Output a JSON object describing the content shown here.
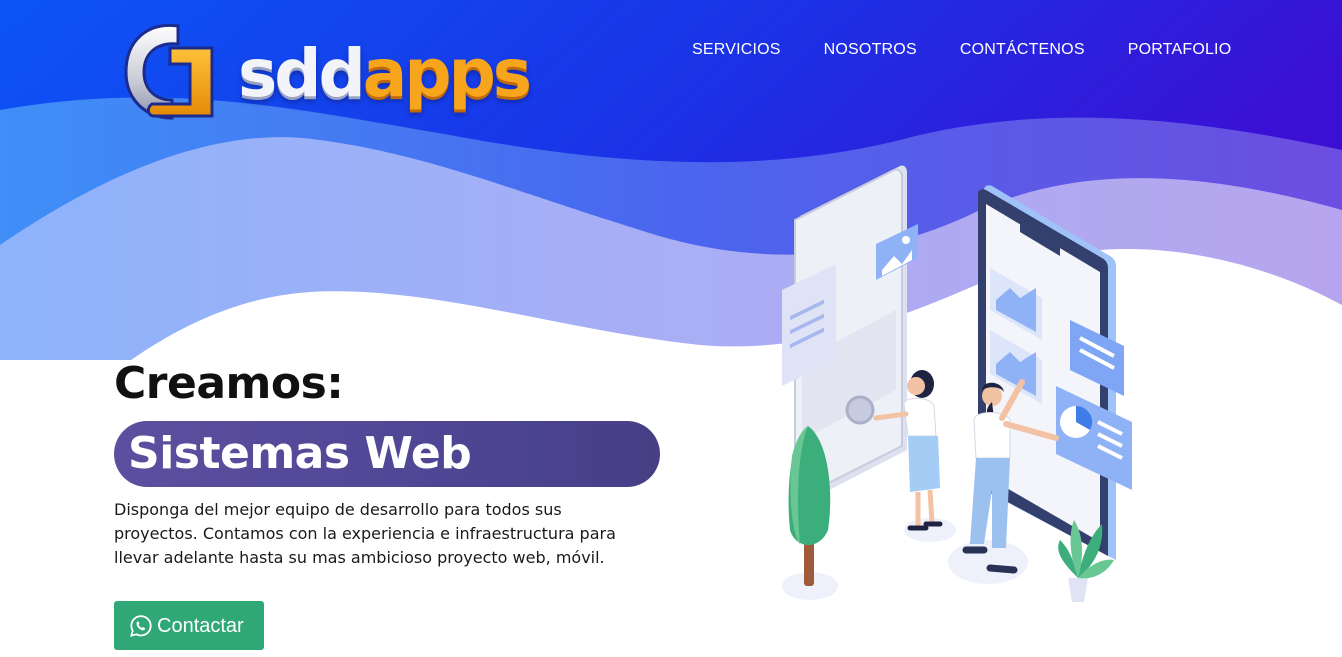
{
  "brand": {
    "logo_text_white": "sdd",
    "logo_text_orange": "apps",
    "logo_icon": "sddapps-logo-mark"
  },
  "nav": {
    "items": [
      {
        "label": "SERVICIOS"
      },
      {
        "label": "NOSOTROS"
      },
      {
        "label": "CONTÁCTENOS"
      },
      {
        "label": "PORTAFOLIO"
      }
    ]
  },
  "hero": {
    "title": "Creamos:",
    "highlight": "Sistemas Web",
    "description": "Disponga del mejor equipo de desarrollo para todos sus proyectos. Contamos con la experiencia e infraestructura para llevar adelante hasta su mas ambicioso proyecto web, móvil.",
    "cta_label": "Contactar",
    "cta_icon": "whatsapp-icon"
  },
  "colors": {
    "header_blue": "#1339ea",
    "header_violet": "#3b16d8",
    "pill": "#504896",
    "cta_green": "#2fa876",
    "logo_orange": "#f7a51c"
  }
}
